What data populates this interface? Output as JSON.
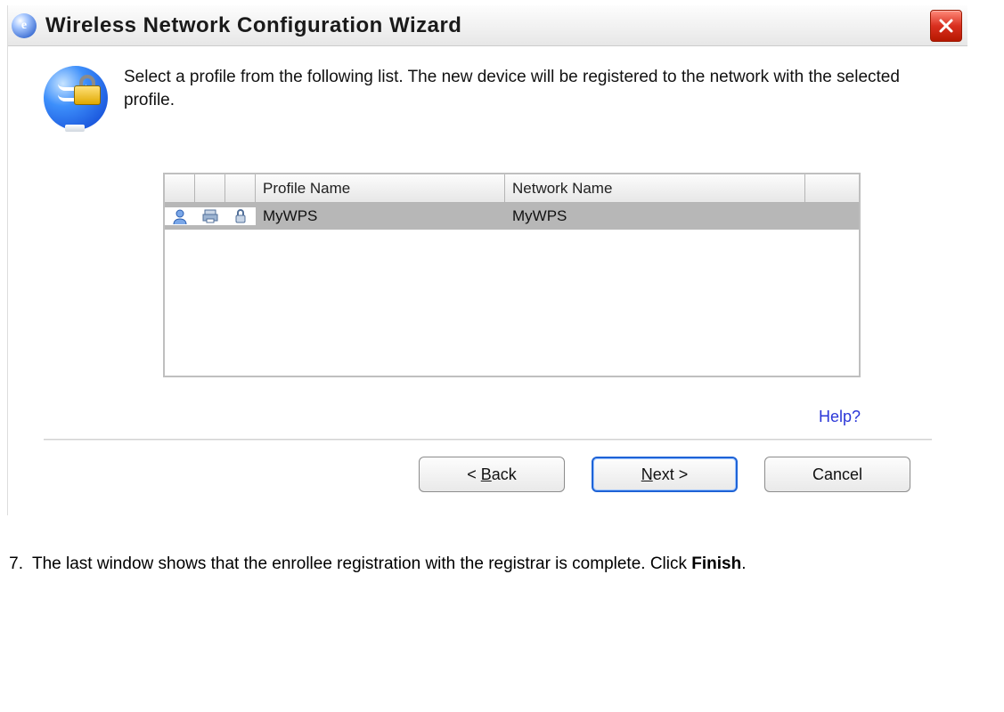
{
  "window": {
    "title": "Wireless Network Configuration Wizard"
  },
  "intro_text": "Select a profile from the following list. The new device will be registered to the network with the selected profile.",
  "table": {
    "headers": {
      "profile": "Profile Name",
      "network": "Network Name"
    },
    "rows": [
      {
        "profile": "MyWPS",
        "network": "MyWPS"
      }
    ]
  },
  "help_label": "Help?",
  "buttons": {
    "back": "< Back",
    "next": "Next >",
    "cancel": "Cancel"
  },
  "doc_step": {
    "number": "7.",
    "text_before": "The last window shows that the enrollee registration with the registrar is complete. Click ",
    "text_bold": "Finish",
    "text_after": "."
  }
}
